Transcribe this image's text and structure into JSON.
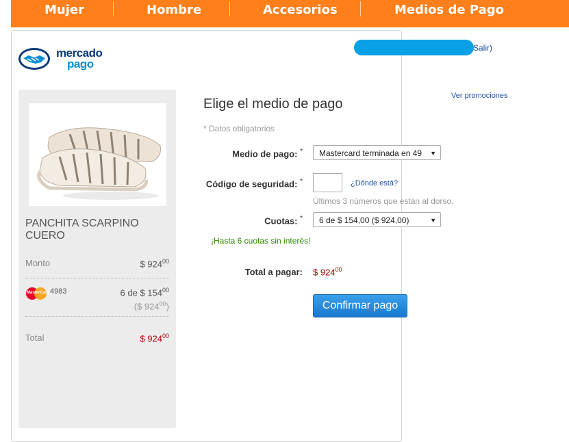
{
  "nav": {
    "items": [
      "Mujer",
      "Hombre",
      "Accesorios",
      "Medios de Pago"
    ],
    "color": "#ff7f1a"
  },
  "header": {
    "logo_line1": "mercado",
    "logo_line2": "pago",
    "logout": "Salir)"
  },
  "summary": {
    "product_name": "PANCHITA SCARPINO CUERO",
    "amount_label": "Monto",
    "amount_value": "$ 924",
    "amount_cents": "00",
    "card_last4": "4983",
    "card_brand_text": "MasterCard",
    "installment_value": "6 de $ 154",
    "installment_cents": "00",
    "installment_total": "($ 924",
    "installment_total_cents": "00",
    "installment_total_close": ")",
    "total_label": "Total",
    "total_value": "$ 924",
    "total_cents": "00"
  },
  "form": {
    "title": "Elige el medio de pago",
    "promo_link": "Ver promociones",
    "required_note": "* Datos obligatorios",
    "payment_method_label": "Medio de pago:",
    "payment_method_value": "Mastercard terminada en 49",
    "security_code_label": "Código de seguridad:",
    "security_code_value": "",
    "where_link": "¿Dónde está?",
    "security_hint": "Últimos 3 números que están al dorso.",
    "installments_label": "Cuotas:",
    "installments_value": "6 de $ 154,00 ($ 924,00)",
    "no_interest": "¡Hasta 6 cuotas sin interés!",
    "total_label": "Total a pagar:",
    "total_value": "$ 924",
    "total_cents": "00",
    "asterisk": "*",
    "confirm_button": "Confirmar pago"
  },
  "colors": {
    "accent_blue": "#1a78cf",
    "price_red": "#b20000",
    "success_green": "#2a8a00"
  }
}
